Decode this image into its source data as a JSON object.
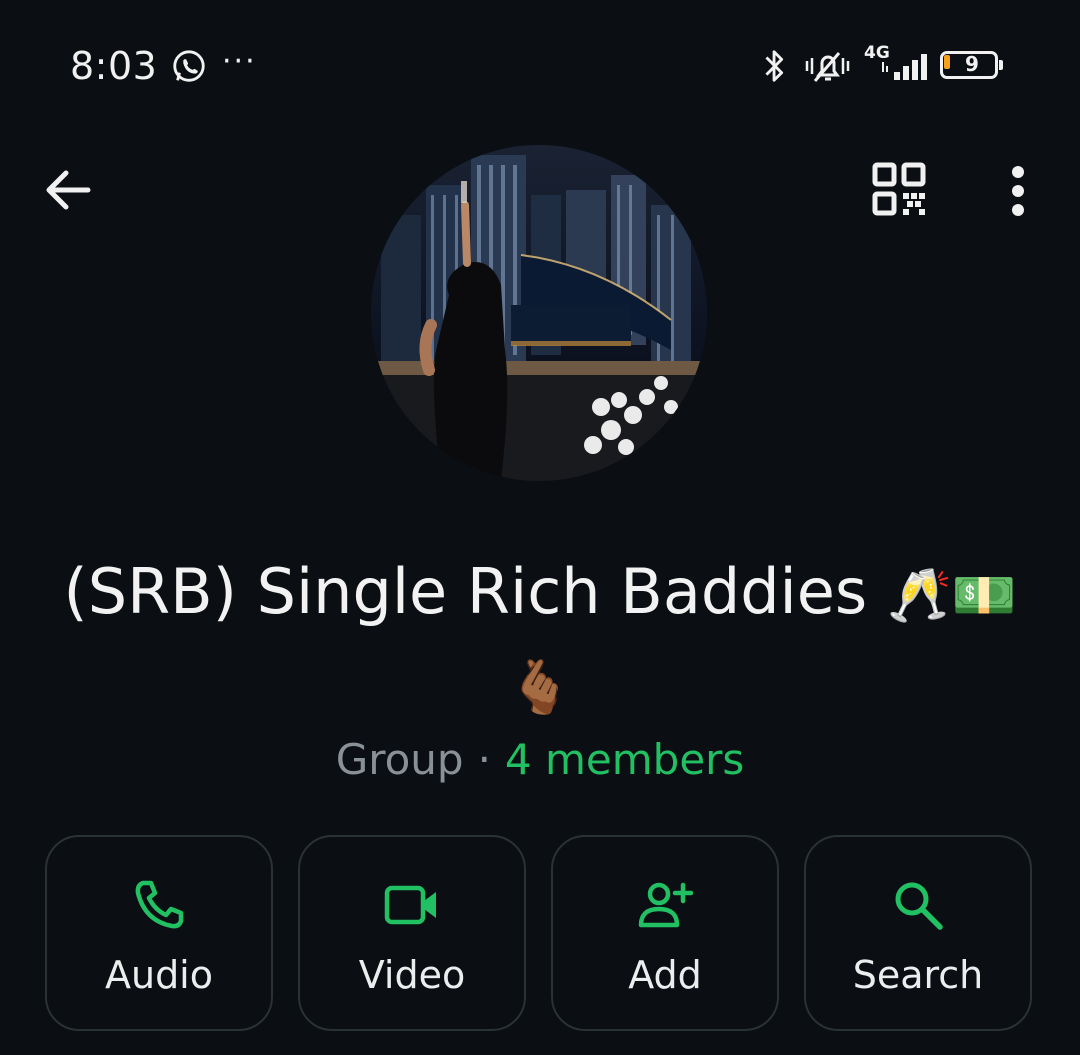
{
  "status_bar": {
    "time": "8:03",
    "dots": "···",
    "network": "4G",
    "battery_level": "9",
    "icons": [
      "whatsapp-icon",
      "bluetooth-icon",
      "mute-icon",
      "signal-icon",
      "battery-icon"
    ]
  },
  "top_bar": {
    "icons": [
      "back-arrow-icon",
      "qr-code-icon",
      "more-vert-icon"
    ]
  },
  "group": {
    "name": "(SRB) Single Rich Baddies",
    "name_emoji_1": "🥂💵",
    "name_emoji_2": "🫰🏾",
    "type": "Group",
    "separator": "·",
    "members": "4 members"
  },
  "actions": [
    {
      "label": "Audio",
      "icon": "phone-icon"
    },
    {
      "label": "Video",
      "icon": "video-camera-icon"
    },
    {
      "label": "Add",
      "icon": "add-person-icon"
    },
    {
      "label": "Search",
      "icon": "search-icon"
    }
  ],
  "colors": {
    "background": "#0b0f13",
    "accent": "#21c063",
    "text": "#e9edef",
    "muted": "#8a9196",
    "border": "#2b3236"
  }
}
